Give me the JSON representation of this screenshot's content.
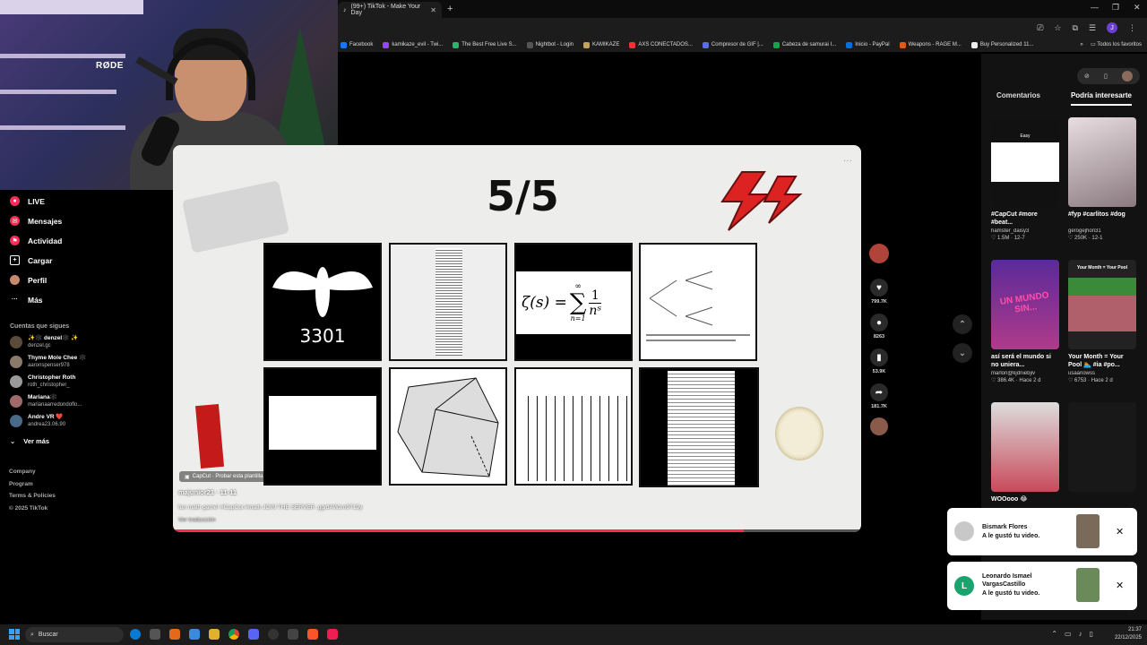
{
  "browser": {
    "tab_title": "(99+) TikTok - Make Your Day",
    "tab_close": "✕",
    "new_tab": "+",
    "window_controls": [
      "—",
      "❐",
      "✕"
    ],
    "profile_initial": "J",
    "bookmarks": [
      "Facebook",
      "kamikaze_evil - Twi...",
      "The Best Free Live S...",
      "Nightbot - Login",
      "KAMIKAZE",
      "AXS CONECTADOS...",
      "Compresor de GIF |...",
      "Cabeza de samurai I...",
      "Inicio - PayPal",
      "Weapons - RAGE M...",
      "Buy Personalized 11..."
    ],
    "bookmarks_more": "»",
    "all_bookmarks": "Todos los favoritos"
  },
  "webcam": {
    "mic_brand": "RØDE"
  },
  "nav": {
    "items": [
      {
        "label": "LIVE",
        "color": "#fe2c55"
      },
      {
        "label": "Mensajes",
        "color": "#fe2c55"
      },
      {
        "label": "Actividad",
        "color": "#fe2c55"
      },
      {
        "label": "Cargar",
        "color": "#ffffff"
      },
      {
        "label": "Perfil",
        "color": "#c98a6a"
      },
      {
        "label": "Más",
        "color": "#ffffff"
      }
    ],
    "following_title": "Cuentas que sigues",
    "following": [
      {
        "name": "✨🕸️ denzel🕸️ ✨",
        "handle": "denzel.gc"
      },
      {
        "name": "Thyme Mole Chee 🕸️",
        "handle": "aaronspenser978"
      },
      {
        "name": "Christopher Roth",
        "handle": "roth_christopher_"
      },
      {
        "name": "Mariana🕸️",
        "handle": "marianaarredondoflo..."
      },
      {
        "name": "Andre VR ❤️",
        "handle": "andrea23.06.90"
      }
    ],
    "see_more": "Ver más",
    "footer": [
      "Company",
      "Program",
      "Terms & Policies",
      "© 2025 TikTok"
    ]
  },
  "video": {
    "title": "5/5",
    "tile_3301": "3301",
    "formula_lhs": "ζ(s) = ",
    "formula_sum_top": "∞",
    "formula_sigma": "∑",
    "formula_sum_bottom": "n=1",
    "formula_num": "1",
    "formula_den": "nˢ",
    "capcut": "CapCut · Probar esta plantilla",
    "author": "majunior21 · 11-11",
    "caption": "fun math game! #CapCut #math JOIN THE SERVER .gg/dAWzm9T19y",
    "translate": "Ver traducción",
    "progress": 0.83
  },
  "actions": {
    "like": "799.7K",
    "comments": "8263",
    "saves": "53.9K",
    "shares": "181.7K"
  },
  "rightpanel": {
    "tab_comments": "Comentarios",
    "tab_interest": "Podría interesarte",
    "cards": [
      {
        "caption": "#CapCut #more #beat...",
        "user": "hamster_daisy3",
        "stats": "♡ 1.5M · 12-7",
        "thumb_label": "Easy"
      },
      {
        "caption": "#fyp #carlitos #dog",
        "user": "gerogejhon31",
        "stats": "♡ 250K · 12-1",
        "thumb_label": ""
      },
      {
        "caption": "así será el mundo si no uniera...",
        "user": "marlon@kjdniebjiv",
        "stats": "♡ 386.4K · Hace 2 d",
        "thumb_label": "UN MUNDO SIN..."
      },
      {
        "caption": "Your Month = Your Pool 🏊 #ia #po...",
        "user": "usaanowss",
        "stats": "♡ 6753 · Hace 2 d",
        "thumb_label": "Your Month = Your Pool"
      },
      {
        "caption": "WOOooo 😂",
        "user": "",
        "stats": "",
        "thumb_label": ""
      },
      {
        "caption": "",
        "user": "",
        "stats": "",
        "thumb_label": ""
      }
    ]
  },
  "notifications": [
    {
      "name": "Bismark Flores",
      "message": "A le gustó tu video.",
      "avatar_color": "#cccccc"
    },
    {
      "name": "Leonardo Ismael VargasCastillo",
      "message": "A le gustó tu video.",
      "avatar_color": "#1aa36f",
      "initial": "L"
    }
  ],
  "taskbar": {
    "search_placeholder": "Buscar",
    "time": "21:37",
    "date": "22/12/2025"
  }
}
